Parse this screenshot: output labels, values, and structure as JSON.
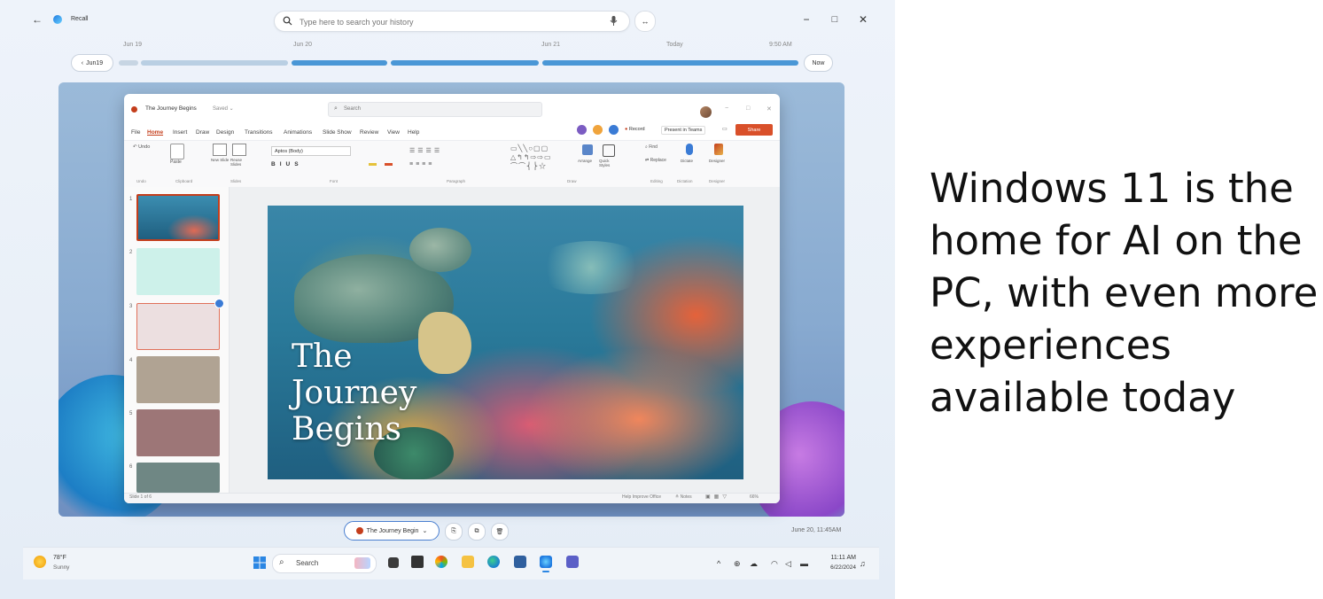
{
  "recall": {
    "app_title": "Recall",
    "search_placeholder": "Type here to search your history",
    "back_date_label": "Jun19",
    "now_label": "Now",
    "timeline_labels": [
      "Jun 19",
      "Jun 20",
      "Jun 21",
      "Today",
      "9:50 AM"
    ],
    "snapshot_app": "The Journey Begin",
    "snapshot_time": "June 20, 11:45AM"
  },
  "powerpoint": {
    "doc_title": "The Journey Begins",
    "saved_status": "Saved",
    "search_placeholder": "Search",
    "menu": [
      "File",
      "Home",
      "Insert",
      "Draw",
      "Design",
      "Transitions",
      "Animations",
      "Slide Show",
      "Review",
      "View",
      "Help"
    ],
    "record_label": "Record",
    "present_label": "Present in Teams",
    "share_label": "Share",
    "font_name": "Aptos (Body)",
    "ribbon_groups": [
      "Undo",
      "Clipboard",
      "Slides",
      "Font",
      "Paragraph",
      "Draw",
      "Editing",
      "Dictation",
      "Designer"
    ],
    "ribbon_buttons": [
      "Paste",
      "New Slide",
      "Reuse Slides",
      "Arrange",
      "Quick Styles",
      "Find",
      "Replace",
      "Dictate",
      "Designer"
    ],
    "slide_numbers": [
      "1",
      "2",
      "3",
      "4",
      "5",
      "6"
    ],
    "slide_title": "The Journey Begins",
    "slide_title_lines": [
      "The",
      "Journey",
      "Begins"
    ],
    "status_left": "Slide 1 of 6",
    "status_help": "Help Improve Office",
    "status_notes": "Notes",
    "zoom": "66%"
  },
  "taskbar": {
    "weather_temp": "78°F",
    "weather_desc": "Sunny",
    "search_label": "Search",
    "time": "11:11 AM",
    "date": "6/22/2024"
  },
  "tagline": {
    "lines": [
      "Windows 11 is the",
      "home for AI on the",
      "PC, with even more",
      "experiences",
      "available today"
    ]
  },
  "colors": {
    "timeline_blue": "#4a97d6",
    "ppt_accent": "#c43e1c",
    "share_orange": "#d9502a"
  }
}
